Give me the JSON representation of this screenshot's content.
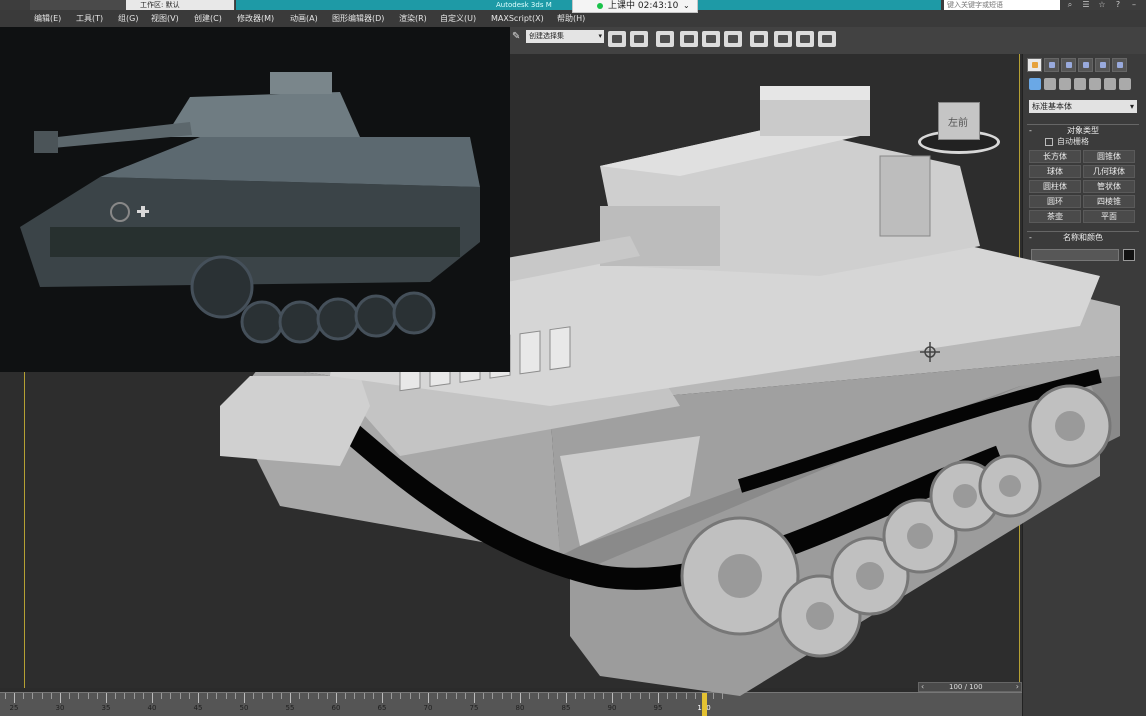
{
  "titlebar": {
    "workspace_label": "工作区: 默认",
    "app_title": "Autodesk 3ds M",
    "search_placeholder": "键入关键字或短语"
  },
  "session": {
    "status_label": "上课中",
    "timer": "02:43:10"
  },
  "menus": [
    "编辑(E)",
    "工具(T)",
    "组(G)",
    "视图(V)",
    "创建(C)",
    "修改器(M)",
    "动画(A)",
    "图形编辑器(D)",
    "渲染(R)",
    "自定义(U)",
    "MAXScript(X)",
    "帮助(H)"
  ],
  "toolbar": {
    "selection_set": "创建选择集"
  },
  "viewcube": {
    "face_label": "左前"
  },
  "command_panel": {
    "category_dropdown": "标准基本体",
    "object_type_header": "对象类型",
    "autogrid_label": "自动栅格",
    "object_buttons": [
      "长方体",
      "圆锥体",
      "球体",
      "几何球体",
      "圆柱体",
      "管状体",
      "圆环",
      "四棱锥",
      "茶壶",
      "平面"
    ],
    "name_color_header": "名称和颜色"
  },
  "timeline": {
    "frame_display": "100 / 100",
    "ruler_labels": [
      "25",
      "30",
      "35",
      "40",
      "45",
      "50",
      "55",
      "60",
      "65",
      "70",
      "75",
      "80",
      "85",
      "90",
      "95",
      "100"
    ],
    "current_frame": 100,
    "accent_color": "#e4c232"
  },
  "colors": {
    "title_accent": "#1e9aa6",
    "viewport_bg": "#2d2d2d",
    "panel_bg": "#3b3b3b"
  }
}
